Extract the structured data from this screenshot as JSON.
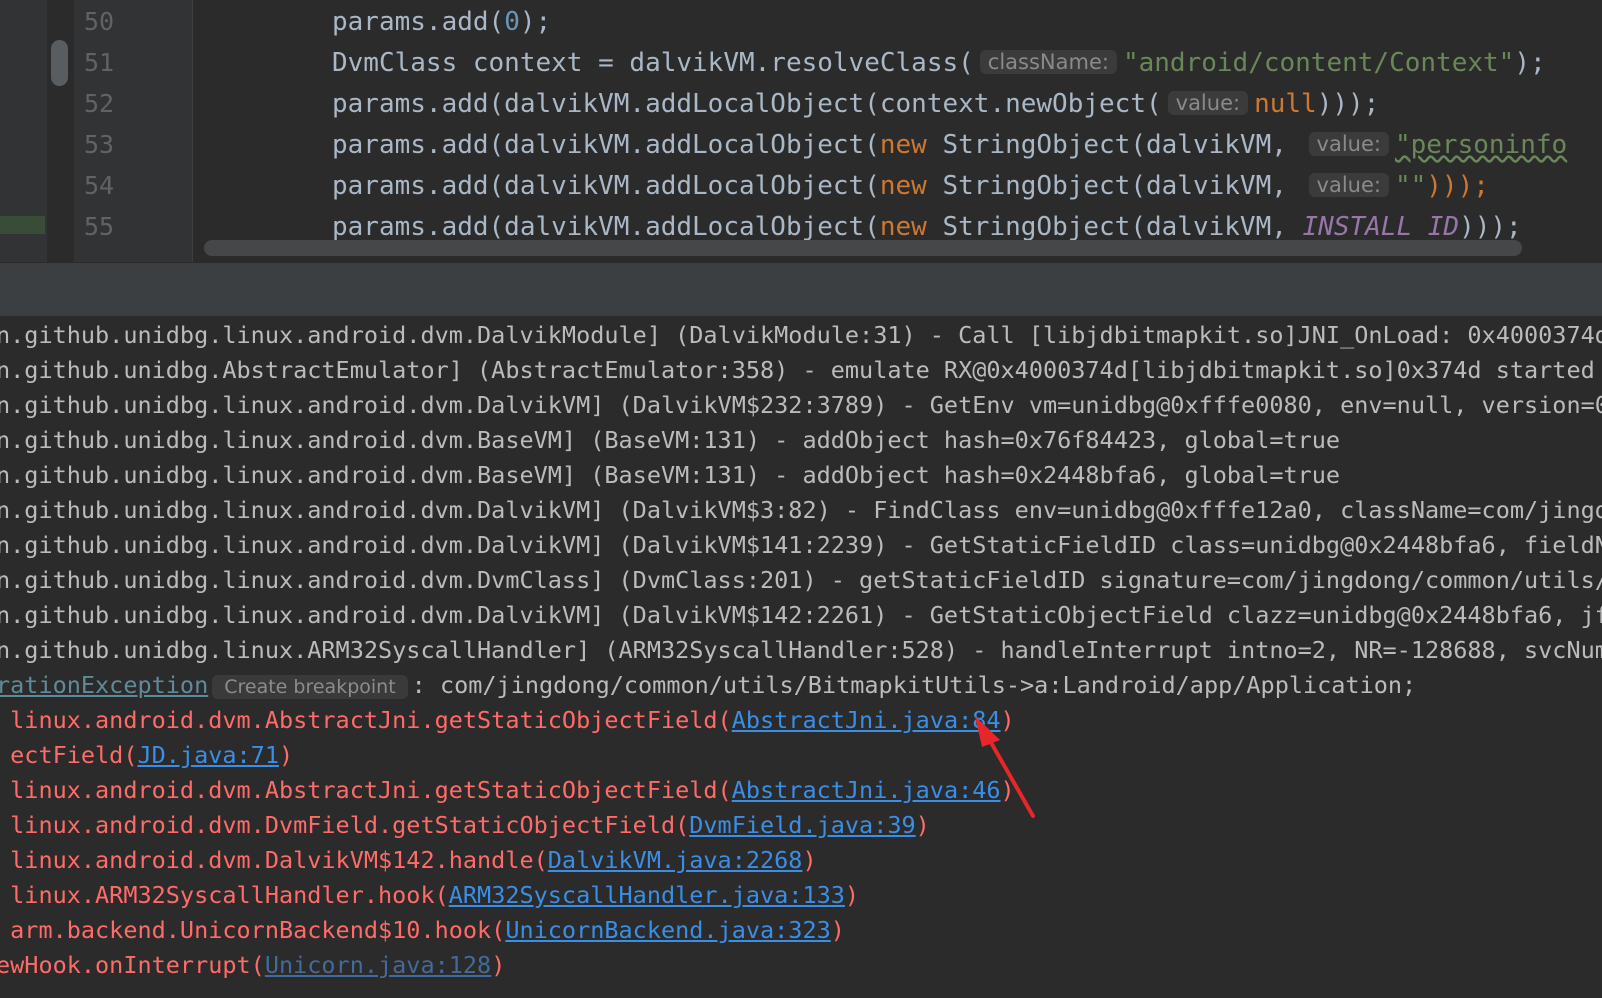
{
  "editor": {
    "line_numbers": [
      "50",
      "51",
      "52",
      "53",
      "54",
      "55"
    ],
    "lines": [
      {
        "a": "params.add(",
        "num": "0",
        "b": ");"
      },
      {
        "a": "DvmClass context = dalvikVM.resolveClass(",
        "hint": "className:",
        "str": "\"android/content/Context\"",
        "b": ");"
      },
      {
        "a": "params.add(dalvikVM.addLocalObject(context.newObject(",
        "hint": "value:",
        "kw": "null",
        "b": ")));"
      },
      {
        "a": "params.add(dalvikVM.addLocalObject(",
        "kw": "new",
        "c": " StringObject(dalvikVM, ",
        "hint": "value:",
        "str": "\"personinfo"
      },
      {
        "a": "params.add(dalvikVM.addLocalObject(",
        "kw": "new",
        "c": " StringObject(dalvikVM, ",
        "hint": "value:",
        "str": "\"\"",
        "b": ")));"
      },
      {
        "a": "params.add(dalvikVM.addLocalObject(",
        "kw": "new",
        "c": " StringObject(dalvikVM, ",
        "const": "INSTALL_ID",
        "b": ")));"
      }
    ]
  },
  "console": {
    "log_lines": [
      "n.github.unidbg.linux.android.dvm.DalvikModule] (DalvikModule:31) - Call [libjdbitmapkit.so]JNI_OnLoad: 0x4000374d",
      "n.github.unidbg.AbstractEmulator] (AbstractEmulator:358) - emulate RX@0x4000374d[libjdbitmapkit.so]0x374d started s",
      "n.github.unidbg.linux.android.dvm.DalvikVM] (DalvikVM$232:3789) - GetEnv vm=unidbg@0xfffe0080, env=null, version=0x",
      "n.github.unidbg.linux.android.dvm.BaseVM] (BaseVM:131) - addObject hash=0x76f84423, global=true",
      "n.github.unidbg.linux.android.dvm.BaseVM] (BaseVM:131) - addObject hash=0x2448bfa6, global=true",
      "n.github.unidbg.linux.android.dvm.DalvikVM] (DalvikVM$3:82) - FindClass env=unidbg@0xfffe12a0, className=com/jingdo",
      "n.github.unidbg.linux.android.dvm.DalvikVM] (DalvikVM$141:2239) - GetStaticFieldID class=unidbg@0x2448bfa6, fieldNa",
      "n.github.unidbg.linux.android.dvm.DvmClass] (DvmClass:201) - getStaticFieldID signature=com/jingdong/common/utils/B",
      "n.github.unidbg.linux.android.dvm.DalvikVM] (DalvikVM$142:2261) - GetStaticObjectField clazz=unidbg@0x2448bfa6, jfi",
      "n.github.unidbg.linux.ARM32SyscallHandler] (ARM32SyscallHandler:528) - handleInterrupt intno=2, NR=-128688, svcNumbe"
    ],
    "exception": {
      "name": "rationException",
      "breakpoint_label": "Create breakpoint",
      "message": ": com/jingdong/common/utils/BitmapkitUtils->a:Landroid/app/Application;"
    },
    "trace": [
      {
        "pre": " linux.android.dvm.AbstractJni.getStaticObjectField(",
        "link": "AbstractJni.java:84",
        "post": ")"
      },
      {
        "pre": " ectField(",
        "link": "JD.java:71",
        "post": ")"
      },
      {
        "pre": " linux.android.dvm.AbstractJni.getStaticObjectField(",
        "link": "AbstractJni.java:46",
        "post": ")"
      },
      {
        "pre": " linux.android.dvm.DvmField.getStaticObjectField(",
        "link": "DvmField.java:39",
        "post": ")"
      },
      {
        "pre": " linux.android.dvm.DalvikVM$142.handle(",
        "link": "DalvikVM.java:2268",
        "post": ")"
      },
      {
        "pre": " linux.ARM32SyscallHandler.hook(",
        "link": "ARM32SyscallHandler.java:133",
        "post": ")"
      },
      {
        "pre": " arm.backend.UnicornBackend$10.hook(",
        "link": "UnicornBackend.java:323",
        "post": ")"
      },
      {
        "pre": "ewHook.onInterrupt(",
        "link": "Unicorn.java:128",
        "post": ")"
      }
    ]
  },
  "colors": {
    "background": "#2b2b2b",
    "annotation_arrow": "#e8262a",
    "link": "#3a8ee6",
    "trace_text": "#ff6b68"
  }
}
